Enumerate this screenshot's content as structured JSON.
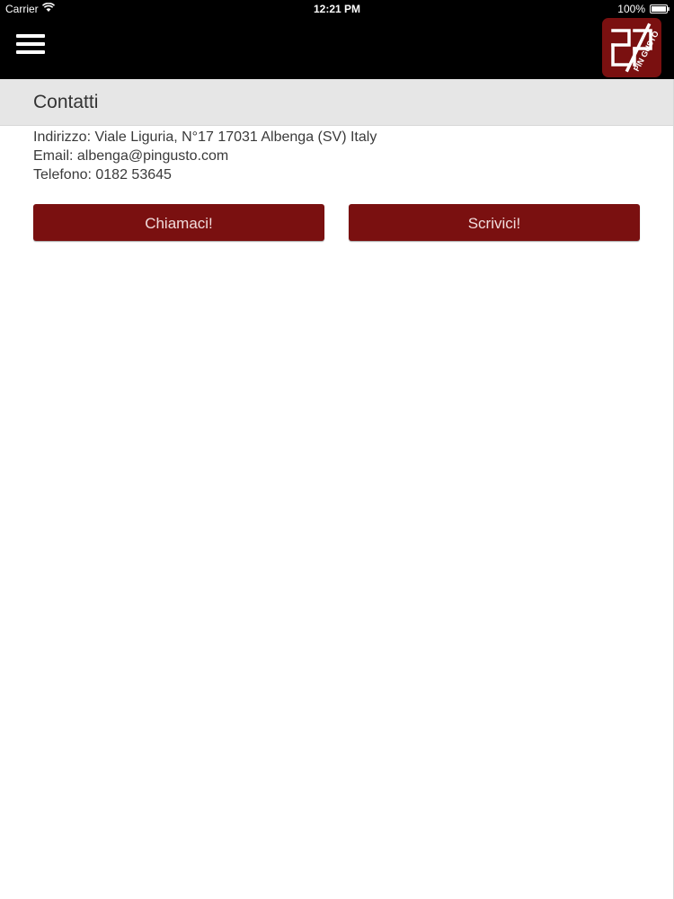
{
  "status_bar": {
    "carrier": "Carrier",
    "time": "12:21 PM",
    "battery": "100%"
  },
  "header": {
    "menu_icon": "hamburger-menu-icon",
    "logo_icon": "pingusto-logo",
    "logo_text": "PIN GUSTO",
    "brand_color": "#7a1010"
  },
  "section": {
    "title": "Contatti"
  },
  "contact": {
    "address": "Indirizzo: Viale Liguria, N°17 17031 Albenga (SV) Italy",
    "email": "Email: albenga@pingusto.com",
    "phone": "Telefono: 0182 53645"
  },
  "actions": {
    "call_label": "Chiamaci!",
    "write_label": "Scrivici!"
  }
}
